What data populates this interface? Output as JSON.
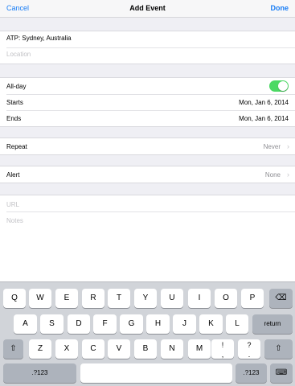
{
  "navbar": {
    "cancel": "Cancel",
    "title": "Add Event",
    "done": "Done"
  },
  "event": {
    "title_value": "ATP: Sydney, Australia",
    "location_placeholder": "Location"
  },
  "timing": {
    "allday_label": "All-day",
    "allday_on": true,
    "starts_label": "Starts",
    "starts_value": "Mon, Jan 6, 2014",
    "ends_label": "Ends",
    "ends_value": "Mon, Jan 6, 2014"
  },
  "repeat": {
    "label": "Repeat",
    "value": "Never"
  },
  "alert": {
    "label": "Alert",
    "value": "None"
  },
  "extra": {
    "url_placeholder": "URL",
    "notes_placeholder": "Notes"
  },
  "keyboard": {
    "row1": [
      "Q",
      "W",
      "E",
      "R",
      "T",
      "Y",
      "U",
      "I",
      "O",
      "P"
    ],
    "row2": [
      "A",
      "S",
      "D",
      "F",
      "G",
      "H",
      "J",
      "K",
      "L"
    ],
    "return": "return",
    "row3": [
      "Z",
      "X",
      "C",
      "V",
      "B",
      "N",
      "M"
    ],
    "punct1": [
      "!",
      ","
    ],
    "punct2": [
      "?",
      "."
    ],
    "numbers_left": ".?123",
    "numbers_right": ".?123"
  },
  "icons": {
    "chevron": "›",
    "delete": "⌫",
    "shift": "⇧",
    "hide_keyboard": "⌨"
  },
  "colors": {
    "accent": "#1a7ef5",
    "toggle_on": "#4cd964"
  }
}
